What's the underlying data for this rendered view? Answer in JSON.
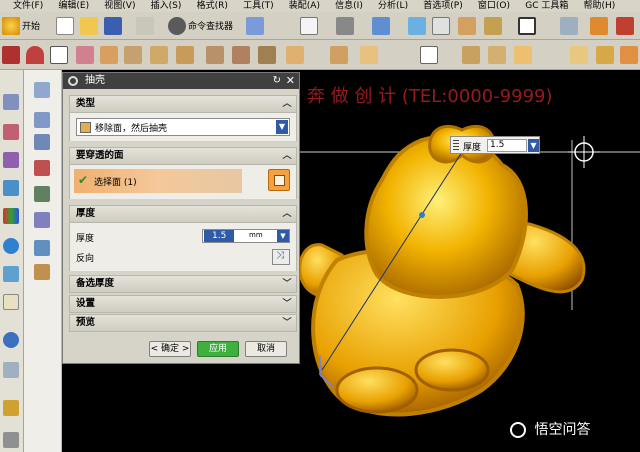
{
  "menubar": {
    "items": [
      "文件(F)",
      "编辑(E)",
      "视图(V)",
      "插入(S)",
      "格式(R)",
      "工具(T)",
      "装配(A)",
      "信息(I)",
      "分析(L)",
      "首选项(P)",
      "窗口(O)",
      "GC 工具箱",
      "帮助(H)"
    ]
  },
  "toolbar": {
    "start_label": "开始",
    "command_finder_label": "命令查找器"
  },
  "viewport": {
    "overlay_text": "奔 做 创 计 (TEL:0000-9999)"
  },
  "dialog": {
    "title": "抽壳",
    "type_section": {
      "header": "类型",
      "selected_type": "移除面，然后抽壳"
    },
    "pierce_section": {
      "header": "要穿透的面",
      "select_label": "选择面 (1)"
    },
    "thickness_section": {
      "header": "厚度",
      "thickness_label": "厚度",
      "thickness_value": "1.5",
      "unit": "mm",
      "reverse_label": "反向"
    },
    "alt_thickness_header": "备选厚度",
    "settings_header": "设置",
    "preview_header": "预览",
    "ok_label": "< 确定 >",
    "apply_label": "应用",
    "cancel_label": "取消"
  },
  "floating_input": {
    "label": "厚度",
    "value": "1.5"
  },
  "watermark": {
    "text": "悟空问答"
  },
  "colors": {
    "accent_orange": "#e8a010",
    "title_bar": "#404040",
    "apply_green": "#3eb03e",
    "model_gold": "#f2b300"
  }
}
